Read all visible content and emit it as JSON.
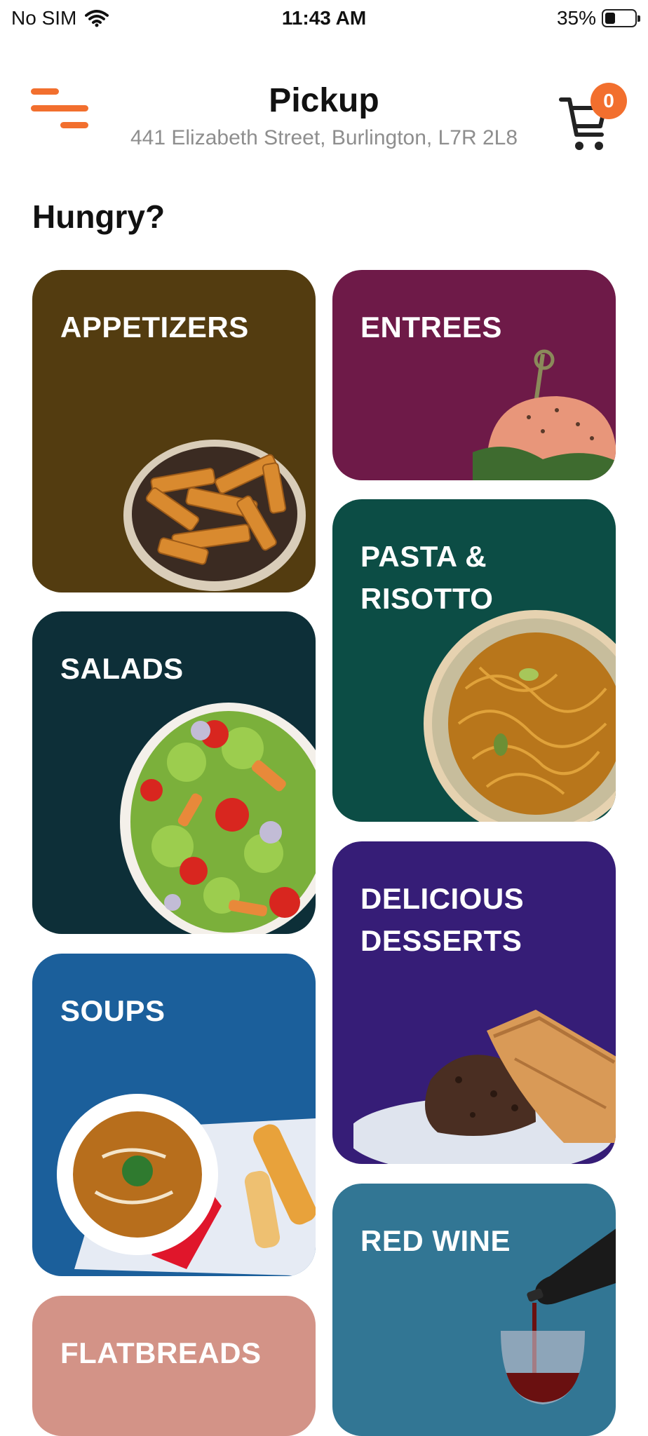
{
  "status_bar": {
    "carrier": "No SIM",
    "time": "11:43 AM",
    "battery_percent": "35%",
    "battery_level": 0.35
  },
  "header": {
    "title": "Pickup",
    "address": "441 Elizabeth Street, Burlington, L7R 2L8",
    "cart_count": "0"
  },
  "greeting": "Hungry?",
  "colors": {
    "accent": "#f26f2e"
  },
  "categories": [
    {
      "label": "APPETIZERS",
      "color": "#533c10",
      "icon": "fries-bowl"
    },
    {
      "label": "ENTREES",
      "color": "#6e1a48",
      "icon": "burger"
    },
    {
      "label": "PASTA &\nRISOTTO",
      "color": "#0c4d45",
      "icon": "noodle-plate"
    },
    {
      "label": "SALADS",
      "color": "#0d2f38",
      "icon": "salad-bowl"
    },
    {
      "label": "DELICIOUS\nDESSERTS",
      "color": "#361d77",
      "icon": "baklava-plate"
    },
    {
      "label": "SOUPS",
      "color": "#1b5f9b",
      "icon": "soup-bowl"
    },
    {
      "label": "RED WINE",
      "color": "#327694",
      "icon": "wine-pour"
    },
    {
      "label": "FLATBREADS",
      "color": "#d39387",
      "icon": "flatbread"
    }
  ]
}
